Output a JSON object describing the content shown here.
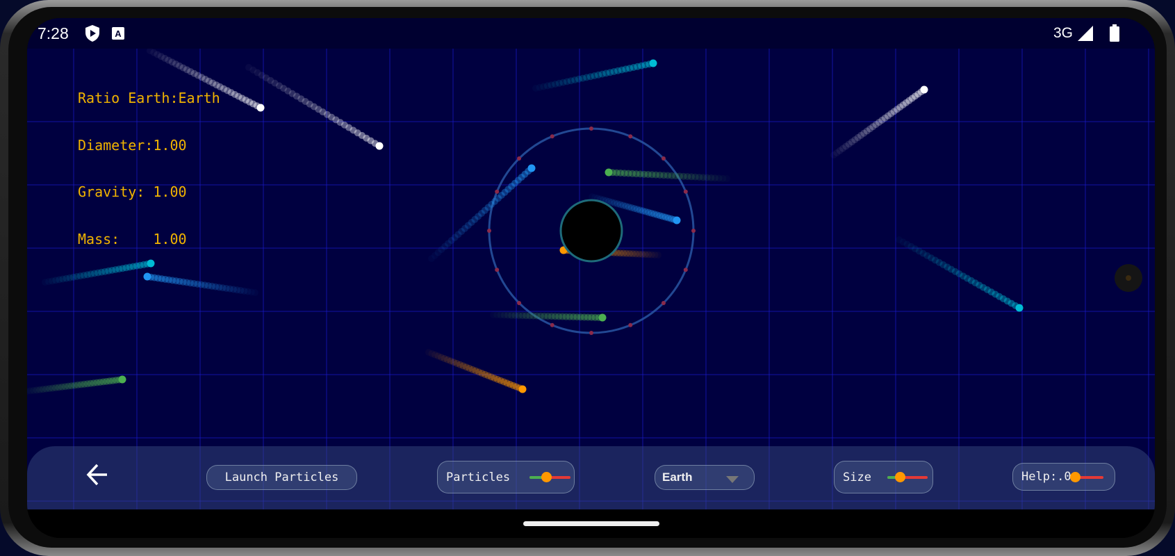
{
  "status_bar": {
    "time": "7:28",
    "network": "3G",
    "icons": [
      "shield-play-icon",
      "font-a-icon",
      "signal-icon",
      "battery-icon"
    ]
  },
  "info": {
    "lines": [
      "Ratio Earth:Earth",
      "Diameter:1.00",
      "Gravity: 1.00",
      "Mass:    1.00"
    ],
    "color": "#f2b400"
  },
  "simulation": {
    "background": "#000040",
    "grid_color": "#1a1acc",
    "planet_ring_color": "#1e6b7a"
  },
  "toolbar": {
    "back_icon": "arrow-left-icon",
    "launch_label": "Launch Particles",
    "particles_label": "Particles",
    "particles_slider_value": 0.4,
    "planet_select_value": "Earth",
    "size_label": "Size",
    "size_slider_value": 0.3,
    "help_label": "Help:.0",
    "help_slider_value": 0.0
  }
}
